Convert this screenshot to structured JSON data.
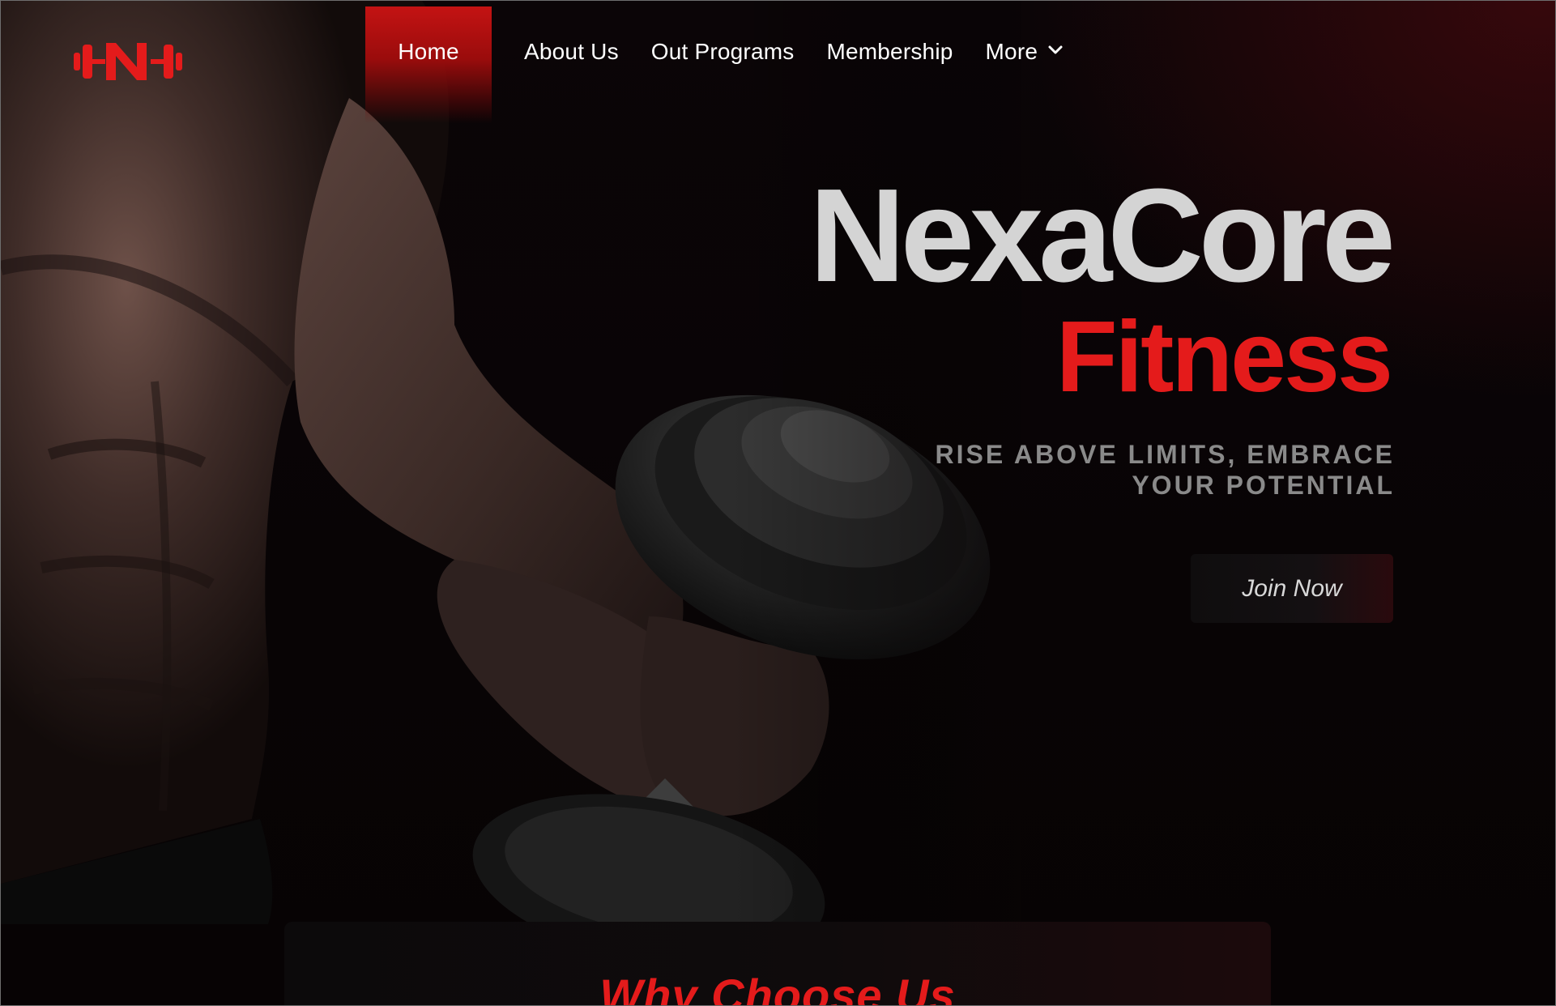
{
  "brand": {
    "logo_text": "N",
    "accent": "#e41b1b",
    "logo_icon": "dumbbell-n-logo-icon"
  },
  "nav": {
    "items": [
      {
        "label": "Home",
        "active": true
      },
      {
        "label": "About Us",
        "active": false
      },
      {
        "label": "Out Programs",
        "active": false
      },
      {
        "label": "Membership",
        "active": false
      },
      {
        "label": "More",
        "active": false,
        "icon": "chevron-down-icon"
      }
    ]
  },
  "hero": {
    "title": "NexaCore",
    "subtitle": "Fitness",
    "tagline": "RISE ABOVE LIMITS, EMBRACE YOUR POTENTIAL",
    "cta_label": "Join Now",
    "image": "muscular-man-holding-dumbbell-photo"
  },
  "why": {
    "title": "Why Choose Us"
  },
  "colors": {
    "background": "#080405",
    "title_gray": "#d4d4d4",
    "tagline_gray": "#8a8a8a",
    "nav_active": "#c41313"
  }
}
